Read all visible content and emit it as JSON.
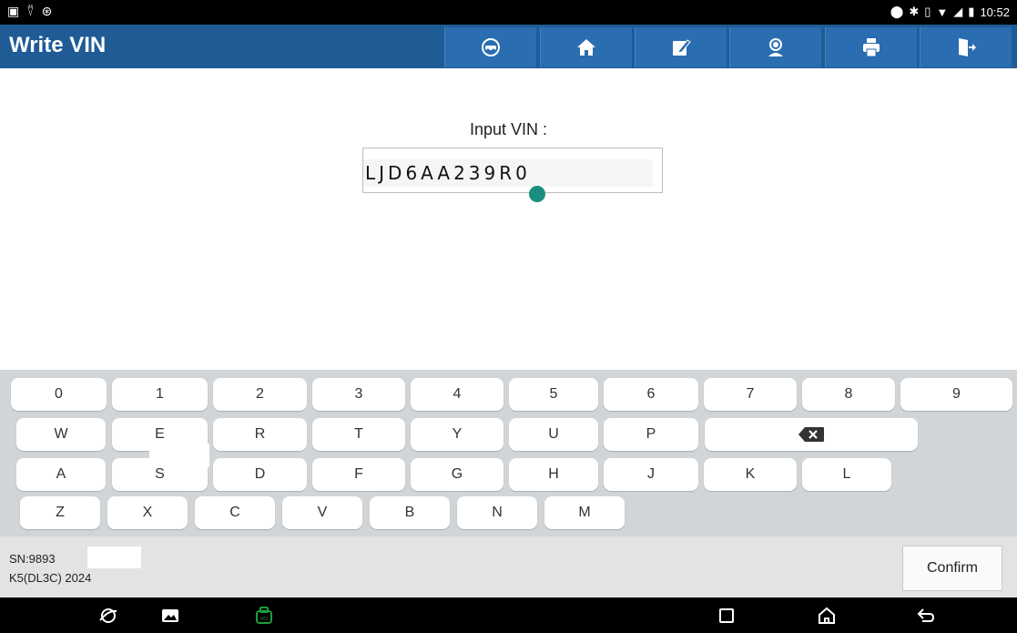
{
  "status_bar": {
    "time": "10:52"
  },
  "header": {
    "title": "Write VIN"
  },
  "toolbar": {
    "buttons": [
      "globe-car-icon",
      "home-icon",
      "edit-icon",
      "support-icon",
      "print-icon",
      "exit-icon"
    ]
  },
  "vin": {
    "label": "Input VIN :",
    "value": "LJD6AA239R0"
  },
  "keyboard": {
    "row1": [
      "0",
      "1",
      "2",
      "3",
      "4",
      "5",
      "6",
      "7",
      "8",
      "9"
    ],
    "row2": [
      "W",
      "E",
      "R",
      "T",
      "Y",
      "U",
      "P"
    ],
    "row3": [
      "A",
      "S",
      "D",
      "F",
      "G",
      "H",
      "J",
      "K",
      "L"
    ],
    "row4": [
      "Z",
      "X",
      "C",
      "V",
      "B",
      "N",
      "M"
    ]
  },
  "footer": {
    "sn": "SN:9893",
    "model": "K5(DL3C) 2024",
    "confirm_label": "Confirm"
  },
  "colors": {
    "accent": "#1f5b95",
    "caret": "#1a8f7f",
    "vci_icon": "#1e9e3a"
  }
}
